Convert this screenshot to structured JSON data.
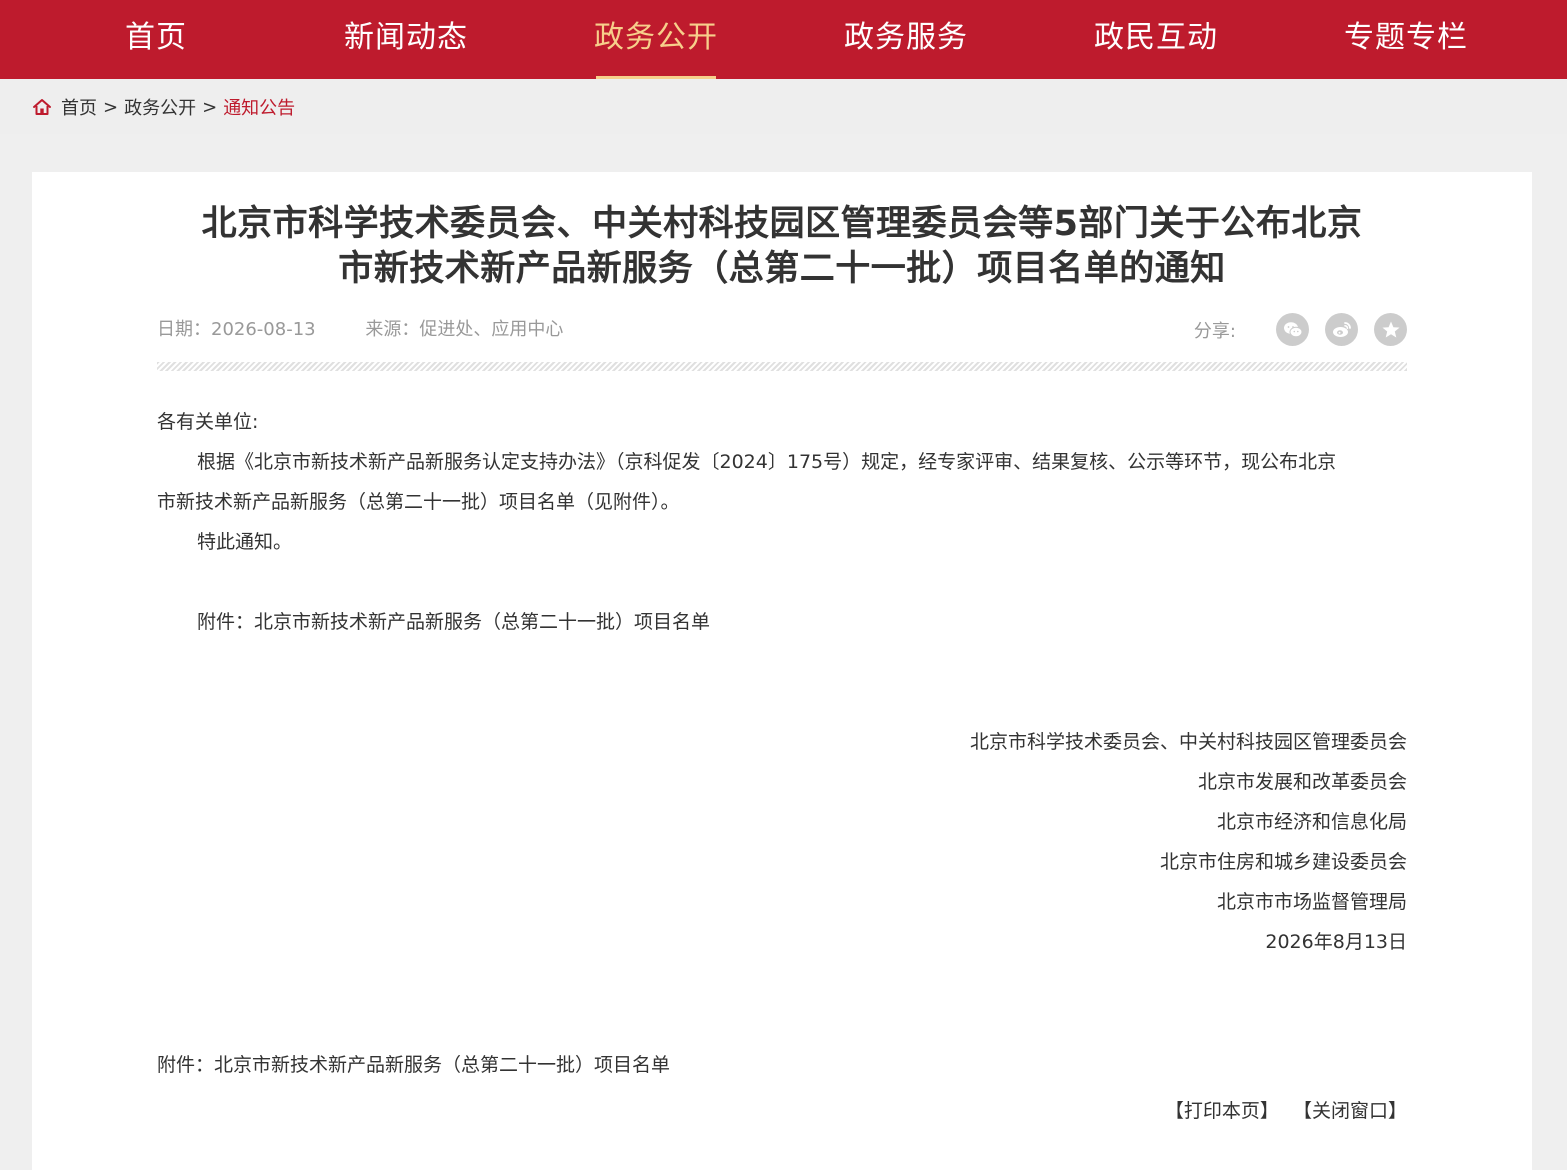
{
  "nav": {
    "items": [
      {
        "label": "首页"
      },
      {
        "label": "新闻动态"
      },
      {
        "label": "政务公开"
      },
      {
        "label": "政务服务"
      },
      {
        "label": "政民互动"
      },
      {
        "label": "专题专栏"
      }
    ],
    "active": "政务公开"
  },
  "breadcrumb": {
    "home": "首页",
    "separator": ">",
    "level1": "政务公开",
    "current": "通知公告"
  },
  "article": {
    "title_line1": "北京市科学技术委员会、中关村科技园区管理委员会等5部门关于公布北京",
    "title_line2": "市新技术新产品新服务（总第二十一批）项目名单的通知",
    "date": "日期：2026-08-13",
    "source": "来源：促进处、应用中心",
    "share_label": "分享:",
    "share_icons": [
      "wechat-icon",
      "weibo-icon",
      "favorite-icon"
    ],
    "salutation": "各有关单位:",
    "para1_line1": "根据《北京市新技术新产品新服务认定支持办法》（京科促发〔2024〕175号）规定，经专家评审、结果复核、公示等环节，现公布北京",
    "para1_line2": "市新技术新产品新服务（总第二十一批）项目名单（见附件）。",
    "closing": "特此通知。",
    "attachment_inline": "附件：北京市新技术新产品新服务（总第二十一批）项目名单",
    "signatories": [
      "北京市科学技术委员会、中关村科技园区管理委员会",
      "北京市发展和改革委员会",
      "北京市经济和信息化局",
      "北京市住房和城乡建设委员会",
      "北京市市场监督管理局"
    ],
    "signed_date": "2026年8月13日",
    "attachment_label": "附件：",
    "attachment_link": "北京市新技术新产品新服务（总第二十一批）项目名单",
    "print_label": "【打印本页】",
    "close_label": "【关闭窗口】"
  },
  "colors": {
    "brand_red": "#be1b2d",
    "nav_active": "#f7cf8b",
    "page_bg": "#efefef"
  }
}
